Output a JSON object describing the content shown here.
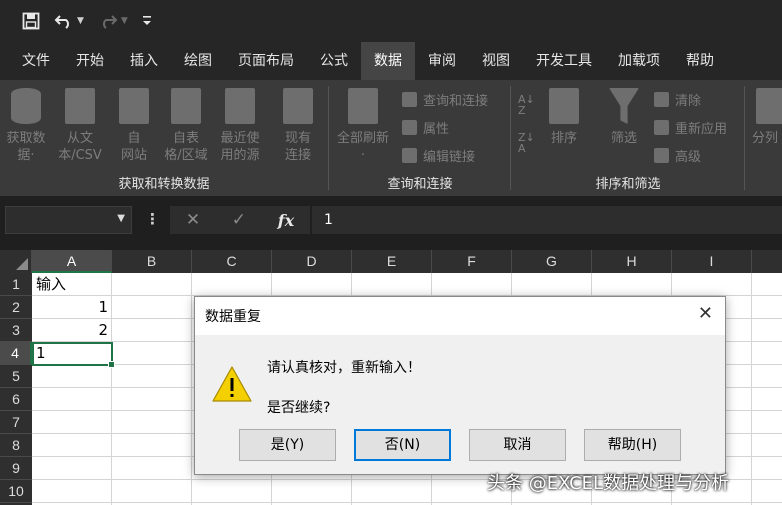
{
  "quick_access": {
    "icons": [
      "save-icon",
      "undo-icon",
      "redo-icon",
      "customize-icon"
    ]
  },
  "tabs": [
    "文件",
    "开始",
    "插入",
    "绘图",
    "页面布局",
    "公式",
    "数据",
    "审阅",
    "视图",
    "开发工具",
    "加载项",
    "帮助"
  ],
  "active_tab": "数据",
  "ribbon": {
    "get_transform": {
      "label": "获取和转换数据",
      "buttons": [
        {
          "l1": "获取数",
          "l2": "据·"
        },
        {
          "l1": "从文",
          "l2": "本/CSV"
        },
        {
          "l1": "自",
          "l2": "网站"
        },
        {
          "l1": "自表",
          "l2": "格/区域"
        },
        {
          "l1": "最近使",
          "l2": "用的源"
        },
        {
          "l1": "现有",
          "l2": "连接"
        }
      ]
    },
    "queries": {
      "label": "查询和连接",
      "refresh": {
        "l1": "全部刷新",
        "l2": "·"
      },
      "small": [
        "查询和连接",
        "属性",
        "编辑链接"
      ]
    },
    "sort_filter": {
      "label": "排序和筛选",
      "sort": "排序",
      "filter": "筛选",
      "small": [
        "清除",
        "重新应用",
        "高级"
      ]
    },
    "partial": "分列"
  },
  "formula_bar": {
    "name_box": "",
    "fx": "fx",
    "value": "1"
  },
  "grid": {
    "columns": [
      "A",
      "B",
      "C",
      "D",
      "E",
      "F",
      "G",
      "H",
      "I"
    ],
    "rows": [
      "1",
      "2",
      "3",
      "4",
      "5",
      "6",
      "7",
      "8",
      "9",
      "10"
    ],
    "cells": {
      "A1": "输入",
      "A2": "1",
      "A3": "2",
      "A4": "1"
    }
  },
  "dialog": {
    "title": "数据重复",
    "message": "请认真核对，重新输入！",
    "question": "是否继续?",
    "buttons": {
      "yes": "是(Y)",
      "no": "否(N)",
      "cancel": "取消",
      "help": "帮助(H)"
    }
  },
  "watermark": "头条 @EXCEL数据处理与分析",
  "colors": {
    "accent_green": "#1f7346",
    "focus_blue": "#0078d7",
    "ribbon_bg": "#3a3a3a",
    "warning_yellow": "#f5d000"
  }
}
